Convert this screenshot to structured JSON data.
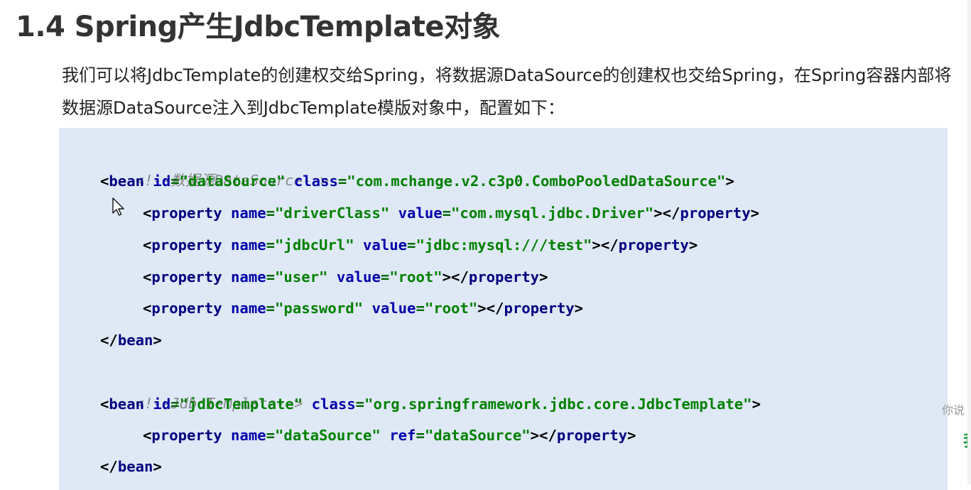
{
  "heading": "1.4 Spring产生JdbcTemplate对象",
  "paragraph": [
    "我们可以将JdbcTemplate的创建权交给Spring，将数据源DataSource的创建权也交给Spring，在Spring容器内部将",
    "数据源DataSource注入到JdbcTemplate模版对象中，配置如下："
  ],
  "code": {
    "comment_datasource": "<!--数据源DataSource-->",
    "comment_jdbctemplate": "<!--JdbcTemplate-->",
    "bean_tag": "bean",
    "property_tag": "property",
    "attr_id": "id",
    "attr_class": "class",
    "attr_name": "name",
    "attr_value": "value",
    "attr_ref": "ref",
    "datasource_bean": {
      "id": "\"dataSource\"",
      "class": "\"com.mchange.v2.c3p0.ComboPooledDataSource\""
    },
    "datasource_properties": [
      {
        "name": "\"driverClass\"",
        "value": "\"com.mysql.jdbc.Driver\""
      },
      {
        "name": "\"jdbcUrl\"",
        "value": "\"jdbc:mysql:///test\""
      },
      {
        "name": "\"user\"",
        "value": "\"root\""
      },
      {
        "name": "\"password\"",
        "value": "\"root\""
      }
    ],
    "jdbctemplate_bean": {
      "id": "\"jdbcTemplate\"",
      "class": "\"org.springframework.jdbc.core.JdbcTemplate\""
    },
    "jdbctemplate_property": {
      "name": "\"dataSource\"",
      "ref": "\"dataSource\""
    }
  },
  "side": {
    "text": "你说",
    "mark": "我"
  },
  "colors": {
    "code_background": "#dfe8f5",
    "tag": "#000080",
    "attribute": "#0000aa",
    "value": "#008000",
    "comment": "#8a8a8a"
  }
}
